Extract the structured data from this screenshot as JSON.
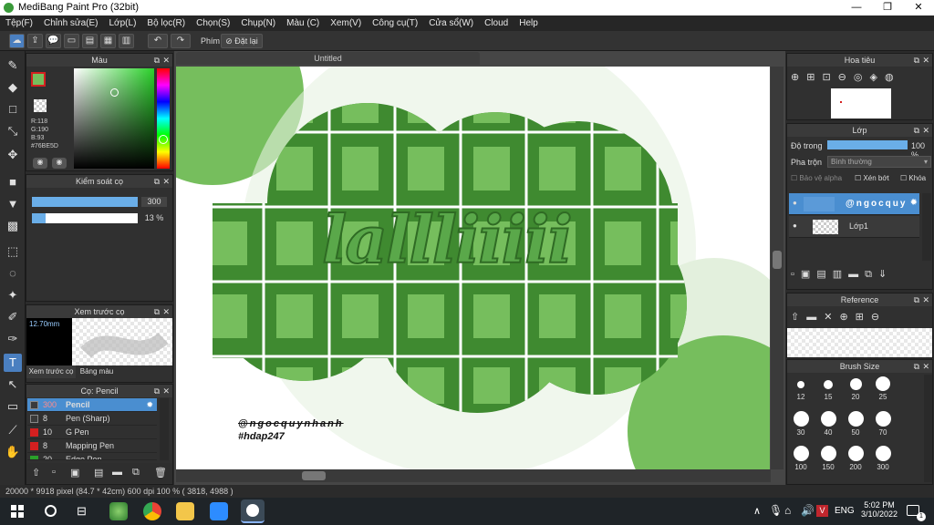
{
  "window": {
    "title": "MediBang Paint Pro (32bit)",
    "min": "—",
    "max": "❐",
    "close": "✕"
  },
  "menu": [
    "Tệp(F)",
    "Chỉnh sửa(E)",
    "Lớp(L)",
    "Bộ lọc(R)",
    "Chọn(S)",
    "Chụp(N)",
    "Màu (C)",
    "Xem(V)",
    "Công cụ(T)",
    "Cửa sổ(W)",
    "Cloud",
    "Help"
  ],
  "toolbar": {
    "hotkey_label": "Phím",
    "reset_label": "Đặt lại"
  },
  "color_panel": {
    "title": "Màu",
    "r": "R:118",
    "g": "G:190",
    "b": "B:93",
    "hex": "#76BE5D",
    "primary": "#76BE5D"
  },
  "brush_control": {
    "title": "Kiểm soát cọ",
    "size": "300",
    "opacity": "13 %",
    "opacity_fraction": 0.13
  },
  "brush_preview": {
    "title": "Xem trước cọ",
    "size": "12.70mm",
    "tab1": "Xem trước cọ",
    "tab2": "Bảng màu"
  },
  "brush_list": {
    "title": "Cọ: Pencil",
    "items": [
      {
        "size": "300",
        "name": "Pencil",
        "color": "#3a3a3a"
      },
      {
        "size": "8",
        "name": "Pen (Sharp)",
        "color": "#3a3a3a"
      },
      {
        "size": "10",
        "name": "G Pen",
        "color": "#d42020"
      },
      {
        "size": "8",
        "name": "Mapping Pen",
        "color": "#d42020"
      },
      {
        "size": "20",
        "name": "Edge Pen",
        "color": "#2aa02a"
      }
    ]
  },
  "document": {
    "tab": "Untitled",
    "text1": "lallliiiii",
    "sig1": "@ngocquynhanh",
    "sig2": "#hdap247",
    "layer_sig": "@ngocquy"
  },
  "navigator": {
    "title": "Hoa tiêu"
  },
  "layer_panel": {
    "title": "Lớp",
    "opacity_label": "Độ trong",
    "opacity_value": "100 %",
    "blend_label": "Pha trộn",
    "blend_value": "Bình thường",
    "protect_alpha": "Bảo vệ alpha",
    "clip": "Xén bớt",
    "lock": "Khóa",
    "layers": [
      "@ngocquy",
      "Lớp1"
    ]
  },
  "reference": {
    "title": "Reference"
  },
  "brush_size": {
    "title": "Brush Size",
    "sizes": [
      "12",
      "15",
      "20",
      "25",
      "30",
      "40",
      "50",
      "70",
      "100",
      "150",
      "200",
      "300"
    ]
  },
  "status": {
    "text": "20000 * 9918 pixel   (84.7 * 42cm)   600 dpi   100 %   ( 3818, 4988 )"
  },
  "taskbar": {
    "lang": "ENG",
    "time": "5:02 PM",
    "date": "3/10/2022",
    "notif": "1"
  }
}
